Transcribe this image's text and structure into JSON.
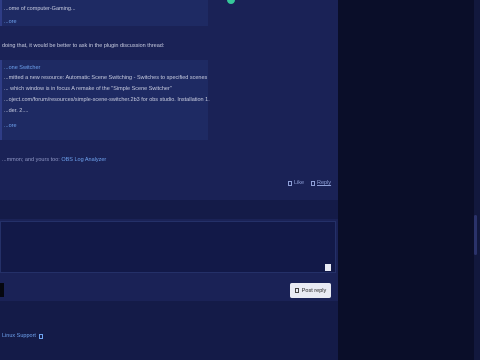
{
  "post": {
    "quote1_line1": "...ome of computer-Gaming...",
    "quote1_more": "...ore",
    "intro": "doing that, it would be better to ask in the plugin discussion thread:",
    "quote2_title": "...one Switcher",
    "quote2_lines": [
      "...mitted a new resource: Automatic Scene Switching - Switches to specified scenes",
      "... which window is in focus A remake of the \"Simple Scene Switcher\"",
      "...oject.com/forum/resources/simple-scene-switcher.2b3 for obs studio. Installation 1.",
      "...der. 2...."
    ],
    "quote2_more": "...ore",
    "signature_prefix": "...mmon; and yours too:",
    "signature_link": "OBS Log Analyzer",
    "like_label": "Like",
    "reply_label": "Reply"
  },
  "reply_box": {
    "post_reply_label": "Post reply"
  },
  "footer": {
    "breadcrumb": "Linux Support"
  }
}
